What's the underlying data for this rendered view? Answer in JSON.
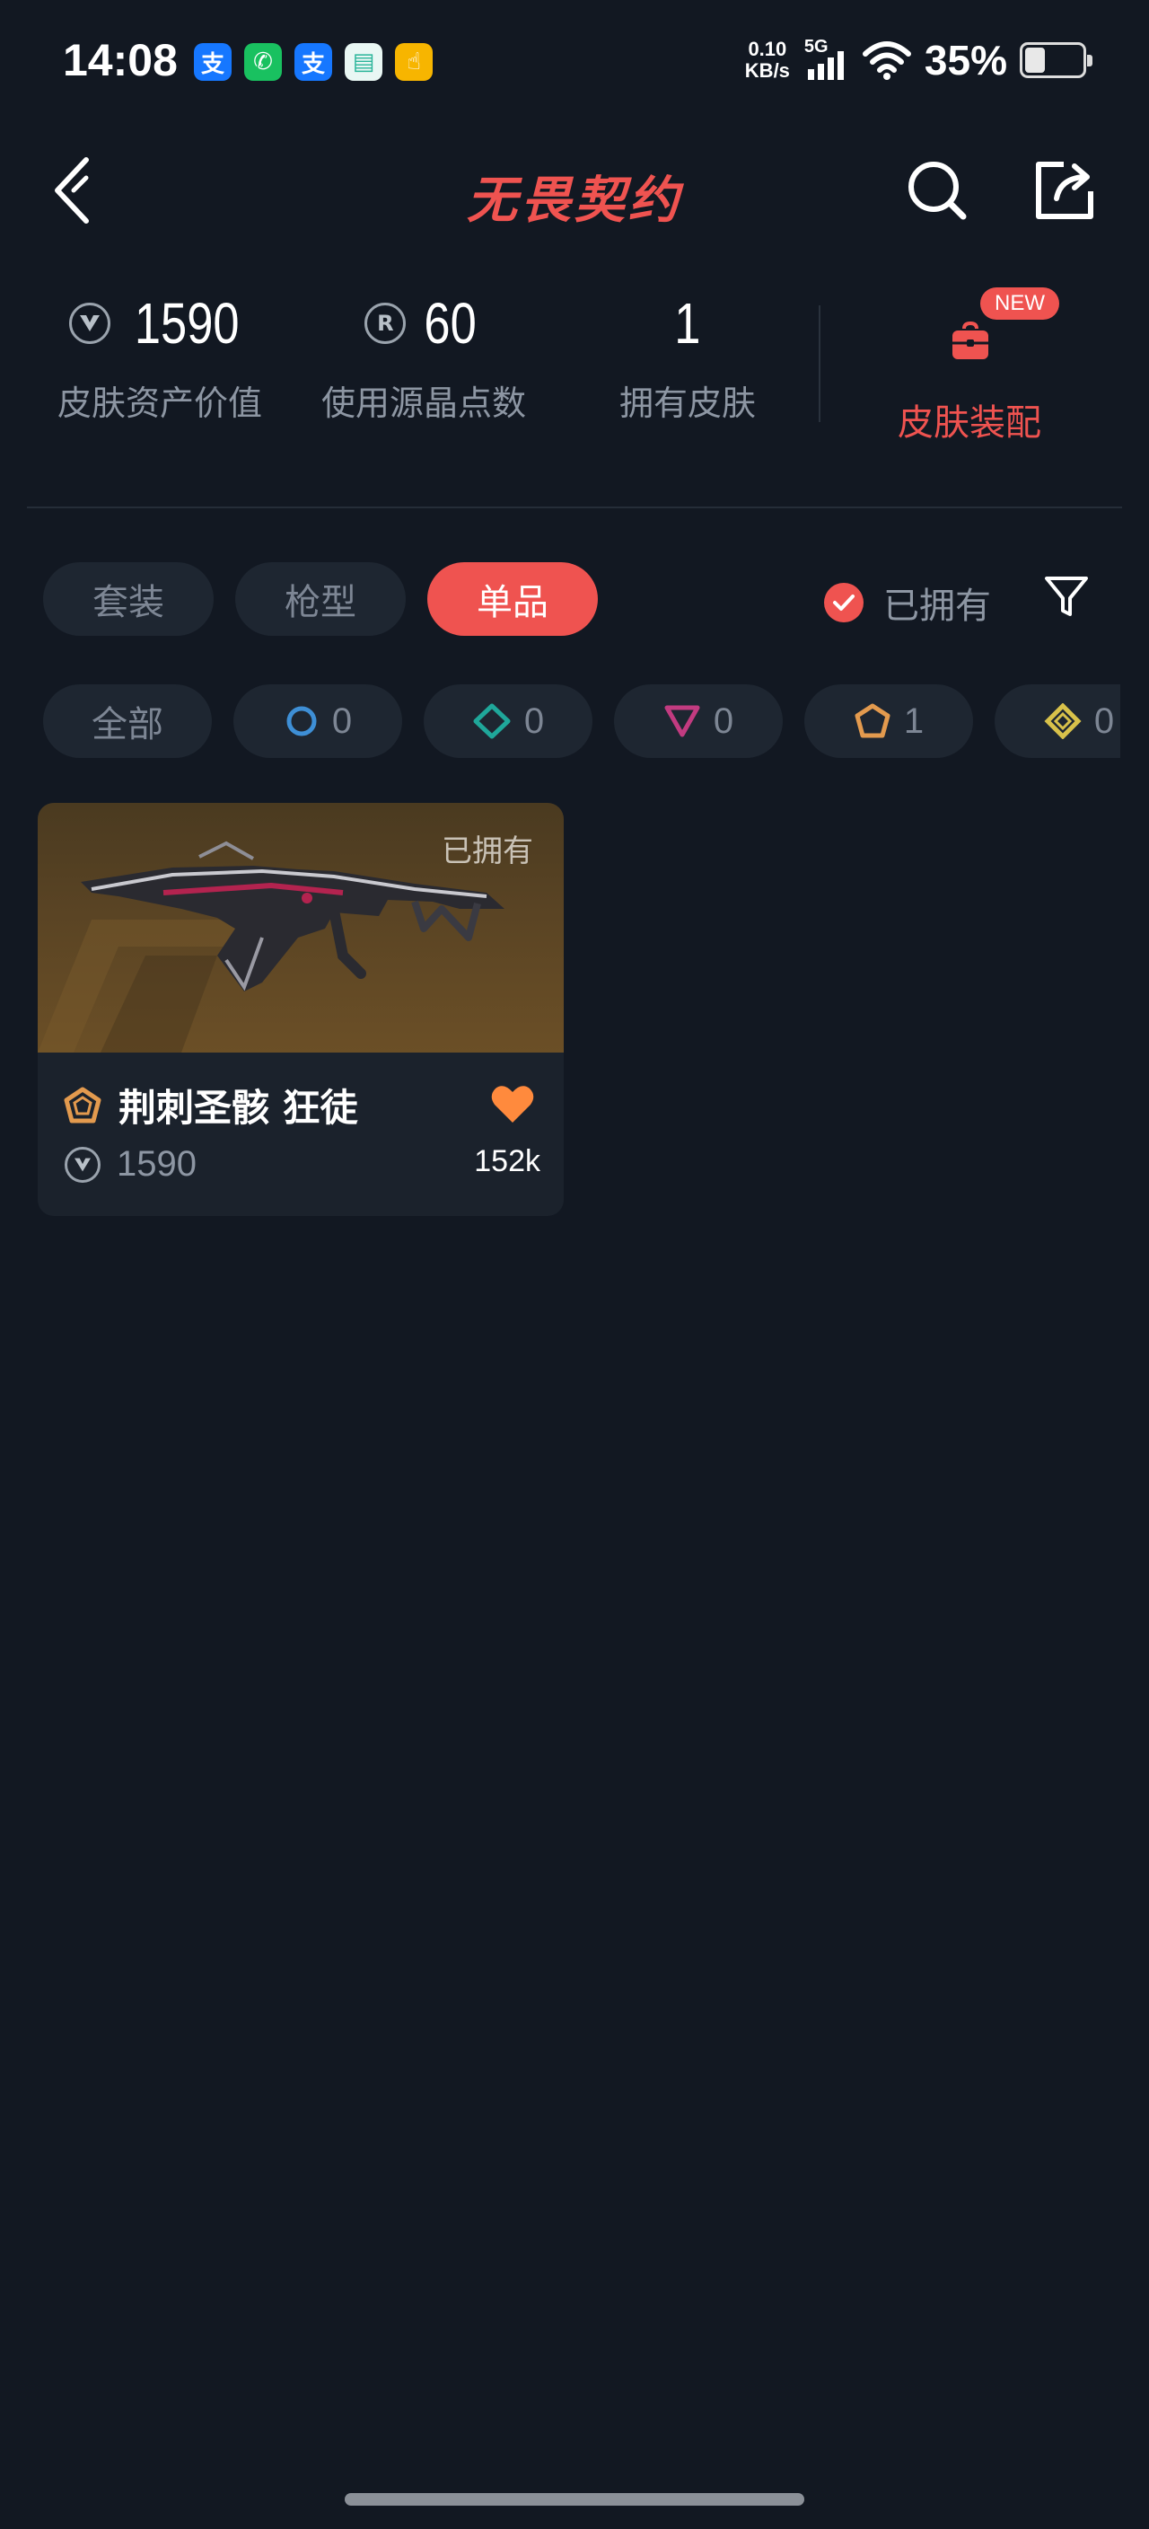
{
  "status_bar": {
    "time": "14:08",
    "app_icons": [
      {
        "name": "alipay-icon",
        "glyph": "支",
        "color": "#1677ff"
      },
      {
        "name": "phone-app-icon",
        "glyph": "✆",
        "color": "#19c160"
      },
      {
        "name": "alipay-icon",
        "glyph": "支",
        "color": "#1677ff"
      },
      {
        "name": "chat-app-icon",
        "glyph": "▤",
        "color": "#e9f7f4"
      },
      {
        "name": "gesture-app-icon",
        "glyph": "☝",
        "color": "#f7b500"
      }
    ],
    "net_speed_value": "0.10",
    "net_speed_unit": "KB/s",
    "network_type": "5G",
    "battery_percent": "35%",
    "battery_level": 0.35
  },
  "header": {
    "logo_text": "无畏契约"
  },
  "stats": {
    "asset_value": "1590",
    "asset_label": "皮肤资产价值",
    "radianite_value": "60",
    "radianite_label": "使用源晶点数",
    "radianite_coin": "R",
    "owned_count": "1",
    "owned_label": "拥有皮肤",
    "equip_badge": "NEW",
    "equip_label": "皮肤装配"
  },
  "tabs": [
    {
      "label": "套装",
      "active": false
    },
    {
      "label": "枪型",
      "active": false
    },
    {
      "label": "单品",
      "active": true
    }
  ],
  "owned_filter": {
    "label": "已拥有",
    "checked": true
  },
  "rarity_chips": [
    {
      "label": "全部"
    },
    {
      "count": "0",
      "tier": "select",
      "color": "#3e8fd6"
    },
    {
      "count": "0",
      "tier": "deluxe",
      "color": "#1fa79a"
    },
    {
      "count": "0",
      "tier": "premium",
      "color": "#c23b80"
    },
    {
      "count": "1",
      "tier": "exclusive",
      "color": "#e39a4e"
    },
    {
      "count": "0",
      "tier": "ultra",
      "color": "#d8c14a"
    }
  ],
  "skin_card": {
    "owned_tag": "已拥有",
    "name": "荆刺圣骸 狂徒",
    "price": "1590",
    "likes": "152k",
    "rarity_color": "#e39a4e",
    "like_color": "#ff8a3d"
  }
}
